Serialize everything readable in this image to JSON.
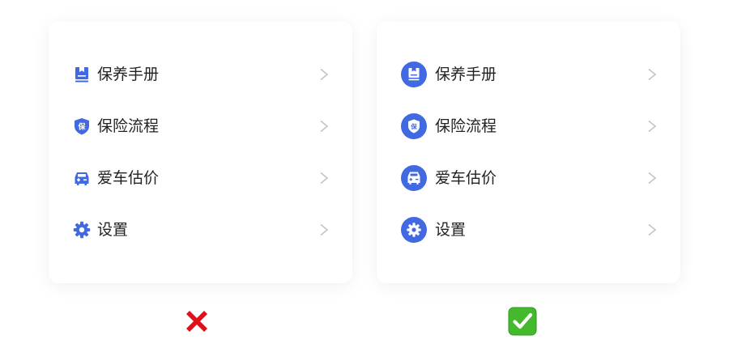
{
  "colors": {
    "accent": "#4169E1",
    "text": "#222222",
    "chevron": "#C4C4C4",
    "bad_mark": "#E0101A",
    "good_mark": "#44B92E"
  },
  "left_card": {
    "variant": "bare-icons",
    "items": [
      {
        "icon": "manual-book-icon",
        "label": "保养手册"
      },
      {
        "icon": "insurance-shield-icon",
        "label": "保险流程"
      },
      {
        "icon": "car-icon",
        "label": "爱车估价"
      },
      {
        "icon": "gear-icon",
        "label": "设置"
      }
    ],
    "chevron_glyph": ">"
  },
  "right_card": {
    "variant": "circle-icons",
    "items": [
      {
        "icon": "manual-book-icon",
        "label": "保养手册"
      },
      {
        "icon": "insurance-shield-icon",
        "label": "保险流程"
      },
      {
        "icon": "car-icon",
        "label": "爱车估价"
      },
      {
        "icon": "gear-icon",
        "label": "设置"
      }
    ],
    "chevron_glyph": ">"
  },
  "verdicts": {
    "left": {
      "icon": "cross-mark-icon",
      "meaning": "wrong"
    },
    "right": {
      "icon": "check-mark-button-icon",
      "meaning": "correct"
    }
  }
}
